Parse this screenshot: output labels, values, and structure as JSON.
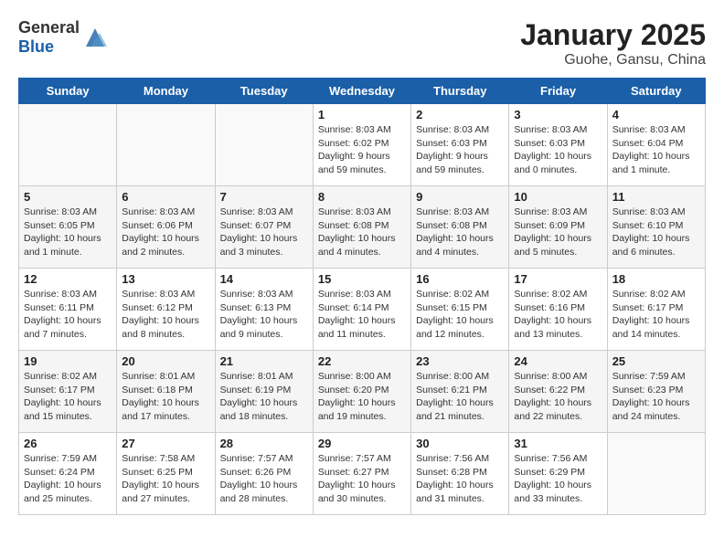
{
  "header": {
    "logo_general": "General",
    "logo_blue": "Blue",
    "title": "January 2025",
    "subtitle": "Guohe, Gansu, China"
  },
  "days_of_week": [
    "Sunday",
    "Monday",
    "Tuesday",
    "Wednesday",
    "Thursday",
    "Friday",
    "Saturday"
  ],
  "weeks": [
    [
      {
        "day": "",
        "info": ""
      },
      {
        "day": "",
        "info": ""
      },
      {
        "day": "",
        "info": ""
      },
      {
        "day": "1",
        "info": "Sunrise: 8:03 AM\nSunset: 6:02 PM\nDaylight: 9 hours and 59 minutes."
      },
      {
        "day": "2",
        "info": "Sunrise: 8:03 AM\nSunset: 6:03 PM\nDaylight: 9 hours and 59 minutes."
      },
      {
        "day": "3",
        "info": "Sunrise: 8:03 AM\nSunset: 6:03 PM\nDaylight: 10 hours and 0 minutes."
      },
      {
        "day": "4",
        "info": "Sunrise: 8:03 AM\nSunset: 6:04 PM\nDaylight: 10 hours and 1 minute."
      }
    ],
    [
      {
        "day": "5",
        "info": "Sunrise: 8:03 AM\nSunset: 6:05 PM\nDaylight: 10 hours and 1 minute."
      },
      {
        "day": "6",
        "info": "Sunrise: 8:03 AM\nSunset: 6:06 PM\nDaylight: 10 hours and 2 minutes."
      },
      {
        "day": "7",
        "info": "Sunrise: 8:03 AM\nSunset: 6:07 PM\nDaylight: 10 hours and 3 minutes."
      },
      {
        "day": "8",
        "info": "Sunrise: 8:03 AM\nSunset: 6:08 PM\nDaylight: 10 hours and 4 minutes."
      },
      {
        "day": "9",
        "info": "Sunrise: 8:03 AM\nSunset: 6:08 PM\nDaylight: 10 hours and 4 minutes."
      },
      {
        "day": "10",
        "info": "Sunrise: 8:03 AM\nSunset: 6:09 PM\nDaylight: 10 hours and 5 minutes."
      },
      {
        "day": "11",
        "info": "Sunrise: 8:03 AM\nSunset: 6:10 PM\nDaylight: 10 hours and 6 minutes."
      }
    ],
    [
      {
        "day": "12",
        "info": "Sunrise: 8:03 AM\nSunset: 6:11 PM\nDaylight: 10 hours and 7 minutes."
      },
      {
        "day": "13",
        "info": "Sunrise: 8:03 AM\nSunset: 6:12 PM\nDaylight: 10 hours and 8 minutes."
      },
      {
        "day": "14",
        "info": "Sunrise: 8:03 AM\nSunset: 6:13 PM\nDaylight: 10 hours and 9 minutes."
      },
      {
        "day": "15",
        "info": "Sunrise: 8:03 AM\nSunset: 6:14 PM\nDaylight: 10 hours and 11 minutes."
      },
      {
        "day": "16",
        "info": "Sunrise: 8:02 AM\nSunset: 6:15 PM\nDaylight: 10 hours and 12 minutes."
      },
      {
        "day": "17",
        "info": "Sunrise: 8:02 AM\nSunset: 6:16 PM\nDaylight: 10 hours and 13 minutes."
      },
      {
        "day": "18",
        "info": "Sunrise: 8:02 AM\nSunset: 6:17 PM\nDaylight: 10 hours and 14 minutes."
      }
    ],
    [
      {
        "day": "19",
        "info": "Sunrise: 8:02 AM\nSunset: 6:17 PM\nDaylight: 10 hours and 15 minutes."
      },
      {
        "day": "20",
        "info": "Sunrise: 8:01 AM\nSunset: 6:18 PM\nDaylight: 10 hours and 17 minutes."
      },
      {
        "day": "21",
        "info": "Sunrise: 8:01 AM\nSunset: 6:19 PM\nDaylight: 10 hours and 18 minutes."
      },
      {
        "day": "22",
        "info": "Sunrise: 8:00 AM\nSunset: 6:20 PM\nDaylight: 10 hours and 19 minutes."
      },
      {
        "day": "23",
        "info": "Sunrise: 8:00 AM\nSunset: 6:21 PM\nDaylight: 10 hours and 21 minutes."
      },
      {
        "day": "24",
        "info": "Sunrise: 8:00 AM\nSunset: 6:22 PM\nDaylight: 10 hours and 22 minutes."
      },
      {
        "day": "25",
        "info": "Sunrise: 7:59 AM\nSunset: 6:23 PM\nDaylight: 10 hours and 24 minutes."
      }
    ],
    [
      {
        "day": "26",
        "info": "Sunrise: 7:59 AM\nSunset: 6:24 PM\nDaylight: 10 hours and 25 minutes."
      },
      {
        "day": "27",
        "info": "Sunrise: 7:58 AM\nSunset: 6:25 PM\nDaylight: 10 hours and 27 minutes."
      },
      {
        "day": "28",
        "info": "Sunrise: 7:57 AM\nSunset: 6:26 PM\nDaylight: 10 hours and 28 minutes."
      },
      {
        "day": "29",
        "info": "Sunrise: 7:57 AM\nSunset: 6:27 PM\nDaylight: 10 hours and 30 minutes."
      },
      {
        "day": "30",
        "info": "Sunrise: 7:56 AM\nSunset: 6:28 PM\nDaylight: 10 hours and 31 minutes."
      },
      {
        "day": "31",
        "info": "Sunrise: 7:56 AM\nSunset: 6:29 PM\nDaylight: 10 hours and 33 minutes."
      },
      {
        "day": "",
        "info": ""
      }
    ]
  ]
}
